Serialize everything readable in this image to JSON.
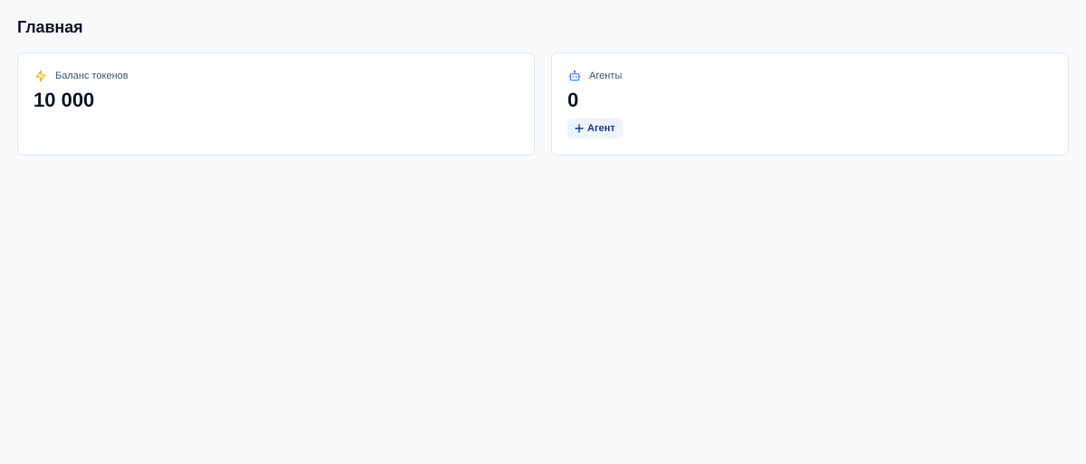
{
  "page": {
    "title": "Главная"
  },
  "cards": {
    "balance": {
      "icon": "lightning-icon",
      "label": "Баланс токенов",
      "value": "10 000",
      "icon_color": "#eab308"
    },
    "agents": {
      "icon": "robot-icon",
      "label": "Агенты",
      "value": "0",
      "icon_color": "#3b82f6",
      "add_button_label": "Агент"
    }
  },
  "colors": {
    "background": "#f8fafc",
    "card_border": "#e2e8f0",
    "button_bg": "#eef4fb",
    "button_text": "#1e3a8a"
  }
}
